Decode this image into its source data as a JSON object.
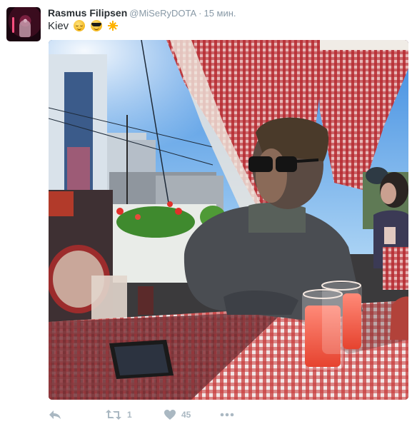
{
  "tweet": {
    "fullname": "Rasmus Filipsen",
    "username": "@MiSeRyDOTA",
    "separator": "·",
    "time": "15 мин.",
    "text": "Kiev",
    "emojis": [
      "relieved-face-emoji",
      "smiling-face-with-sunglasses-emoji",
      "sun-emoji"
    ]
  },
  "actions": {
    "reply_icon": "reply-icon",
    "retweet_icon": "retweet-icon",
    "retweet_count": "1",
    "like_icon": "heart-icon",
    "like_count": "45",
    "more_icon": "more-options-icon"
  },
  "colors": {
    "name": "#292f33",
    "meta": "#8899a6",
    "action": "#aab8c2"
  }
}
